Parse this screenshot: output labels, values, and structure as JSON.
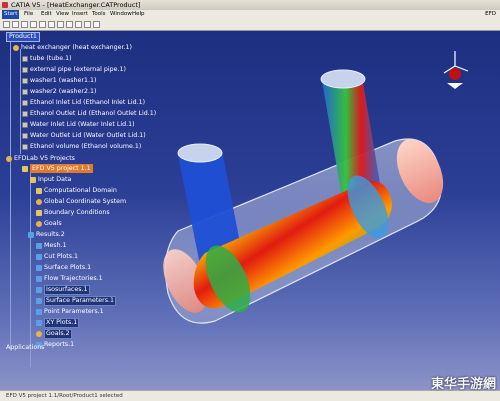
{
  "window": {
    "title": "CATIA V5 - [HeatExchanger.CATProduct]"
  },
  "menu": {
    "items": [
      "Start",
      "File",
      "Edit",
      "View",
      "Insert",
      "Tools",
      "Window",
      "Help"
    ],
    "right_label": "EFD"
  },
  "tree": {
    "root": "Product1",
    "assembly": "heat exchanger (heat exchanger.1)",
    "parts": [
      "tube (tube.1)",
      "external pipe (external pipe.1)",
      "washer1 (washer1.1)",
      "washer2 (washer2.1)",
      "Ethanol Inlet Lid (Ethanol Inlet Lid.1)",
      "Ethanol Outlet Lid (Ethanol Outlet Lid.1)",
      "Water Inlet Lid (Water Inlet Lid.1)",
      "Water Outlet Lid (Water Outlet Lid.1)",
      "Ethanol volume (Ethanol volume.1)"
    ],
    "projects_label": "EFDLab V5 Projects",
    "project": "EFD V5 project 1.1",
    "input_data": "Input Data",
    "input_items": [
      "Computational Domain",
      "Global Coordinate System",
      "Boundary Conditions",
      "Goals"
    ],
    "results": "Results.2",
    "result_items": [
      "Mesh.1",
      "Cut Plots.1",
      "Surface Plots.1",
      "Flow Trajectories.1",
      "Isosurfaces.1",
      "Surface Parameters.1",
      "Point Parameters.1",
      "XY Plots.1",
      "Goals.2",
      "Reports.1"
    ],
    "applications": "Applications"
  },
  "status": {
    "text": "EFD V5 project 1.1/Root/Product1 selected"
  },
  "watermark": "東华手游網"
}
